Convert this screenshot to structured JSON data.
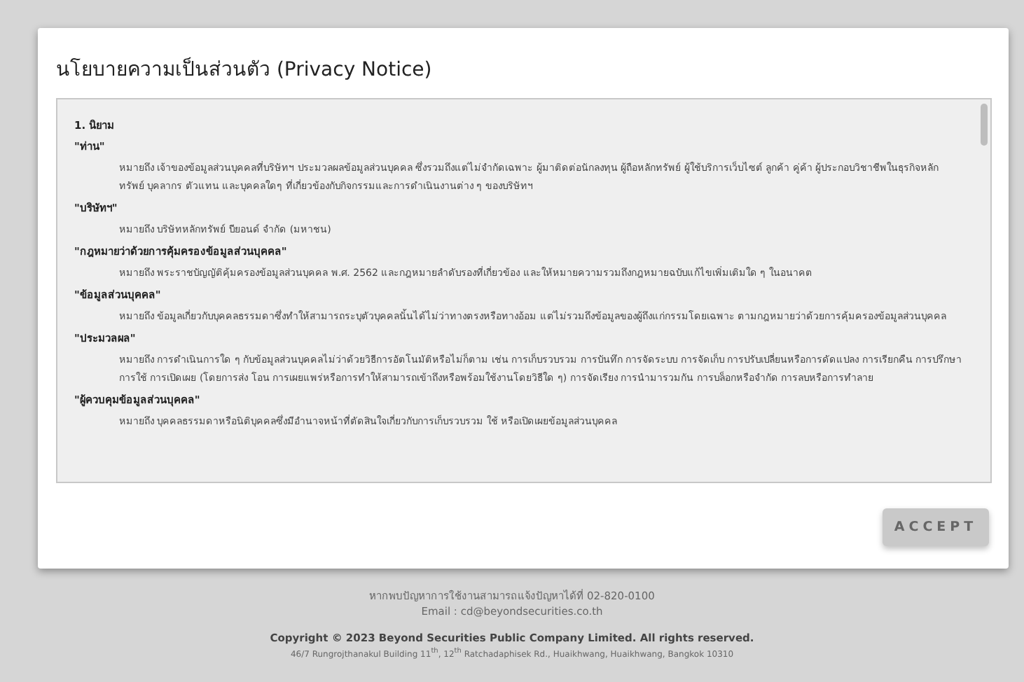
{
  "dialog": {
    "title": "นโยบายความเป็นส่วนตัว (Privacy Notice)",
    "section_heading": "1. นิยาม",
    "definitions": [
      {
        "term": "\"ท่าน\"",
        "meaning": "หมายถึง เจ้าของข้อมูลส่วนบุคคลที่บริษัทฯ ประมวลผลข้อมูลส่วนบุคคล ซึ่งรวมถึงแต่ไม่จำกัดเฉพาะ ผู้มาติดต่อนักลงทุน ผู้ถือหลักทรัพย์ ผู้ใช้บริการเว็บไซต์ ลูกค้า คู่ค้า ผู้ประกอบวิชาชีพในธุรกิจหลักทรัพย์ บุคลากร ตัวแทน และบุคคลใดๆ ที่เกี่ยวข้องกับกิจกรรมและการดำเนินงานต่าง ๆ ของบริษัทฯ"
      },
      {
        "term": "\"บริษัทฯ\"",
        "meaning": "หมายถึง บริษัทหลักทรัพย์ บียอนด์ จำกัด (มหาชน)"
      },
      {
        "term": "\"กฎหมายว่าด้วยการคุ้มครองข้อมูลส่วนบุคคล\"",
        "meaning": "หมายถึง พระราชบัญญัติคุ้มครองข้อมูลส่วนบุคคล พ.ศ. 2562 และกฎหมายลำดับรองที่เกี่ยวข้อง และให้หมายความรวมถึงกฎหมายฉบับแก้ไขเพิ่มเติมใด ๆ ในอนาคต"
      },
      {
        "term": "\"ข้อมูลส่วนบุคคล\"",
        "meaning": "หมายถึง ข้อมูลเกี่ยวกับบุคคลธรรมดาซึ่งทำให้สามารถระบุตัวบุคคลนั้นได้ไม่ว่าทางตรงหรือทางอ้อม แต่ไม่รวมถึงข้อมูลของผู้ถึงแก่กรรมโดยเฉพาะ ตามกฎหมายว่าด้วยการคุ้มครองข้อมูลส่วนบุคคล"
      },
      {
        "term": "\"ประมวลผล\"",
        "meaning": "หมายถึง การดำเนินการใด ๆ กับข้อมูลส่วนบุคคลไม่ว่าด้วยวิธีการอัตโนมัติหรือไม่ก็ตาม เช่น การเก็บรวบรวม การบันทึก การจัดระบบ การจัดเก็บ การปรับเปลี่ยนหรือการดัดแปลง การเรียกคืน การปรึกษา การใช้ การเปิดเผย (โดยการส่ง โอน การเผยแพร่หรือการทำให้สามารถเข้าถึงหรือพร้อมใช้งานโดยวิธีใด ๆ) การจัดเรียง การนำมารวมกัน การบล็อกหรือจำกัด การลบหรือการทำลาย"
      },
      {
        "term": "\"ผู้ควบคุมข้อมูลส่วนบุคคล\"",
        "meaning": "หมายถึง บุคคลธรรมดาหรือนิติบุคคลซึ่งมีอำนาจหน้าที่ตัดสินใจเกี่ยวกับการเก็บรวบรวม ใช้ หรือเปิดเผยข้อมูลส่วนบุคคล"
      }
    ],
    "accept_button": "ACCEPT"
  },
  "footer": {
    "contact": "หากพบปัญหาการใช้งานสามารถแจ้งปัญหาได้ที่ 02-820-0100",
    "email": "Email : cd@beyondsecurities.co.th",
    "copyright": "Copyright © 2023 Beyond Securities Public Company Limited. All rights reserved.",
    "address": "46/7 Rungrojthanakul Building 11$^{th}$, 12$^{th}$ Ratchadaphisek Rd., Huaikhwang, Huaikhwang, Bangkok 10310"
  }
}
